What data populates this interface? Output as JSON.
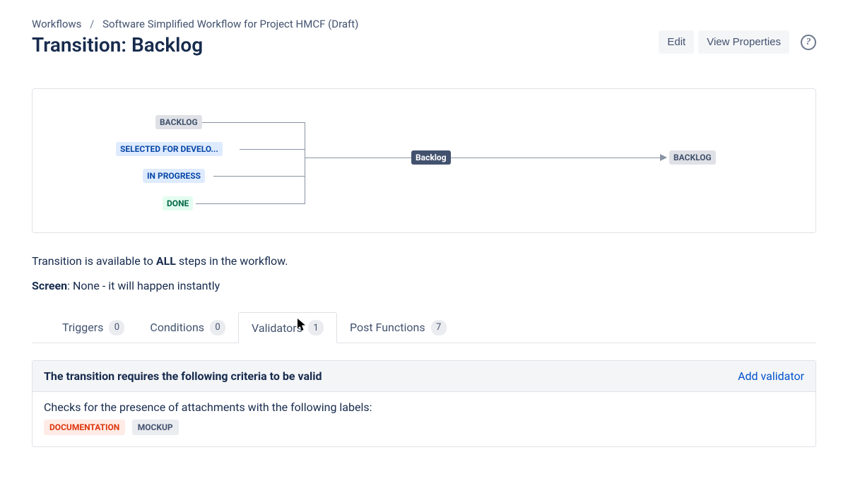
{
  "breadcrumb": {
    "root": "Workflows",
    "sep": "/",
    "current": "Software Simplified Workflow for Project HMCF (Draft)"
  },
  "title": "Transition: Backlog",
  "actions": {
    "edit": "Edit",
    "view_properties": "View Properties"
  },
  "diagram": {
    "sources": [
      "BACKLOG",
      "SELECTED FOR DEVELO...",
      "IN PROGRESS",
      "DONE"
    ],
    "transition": "Backlog",
    "target": "BACKLOG"
  },
  "info1_pre": "Transition is available to ",
  "info1_bold": "ALL",
  "info1_post": " steps in the workflow.",
  "info2_label": "Screen",
  "info2_value": ": None - it will happen instantly",
  "tabs": [
    {
      "label": "Triggers",
      "count": "0"
    },
    {
      "label": "Conditions",
      "count": "0"
    },
    {
      "label": "Validators",
      "count": "1"
    },
    {
      "label": "Post Functions",
      "count": "7"
    }
  ],
  "panel": {
    "title": "The transition requires the following criteria to be valid",
    "add": "Add validator",
    "desc": "Checks for the presence of attachments with the following labels:",
    "labels": [
      "DOCUMENTATION",
      "MOCKUP"
    ]
  }
}
